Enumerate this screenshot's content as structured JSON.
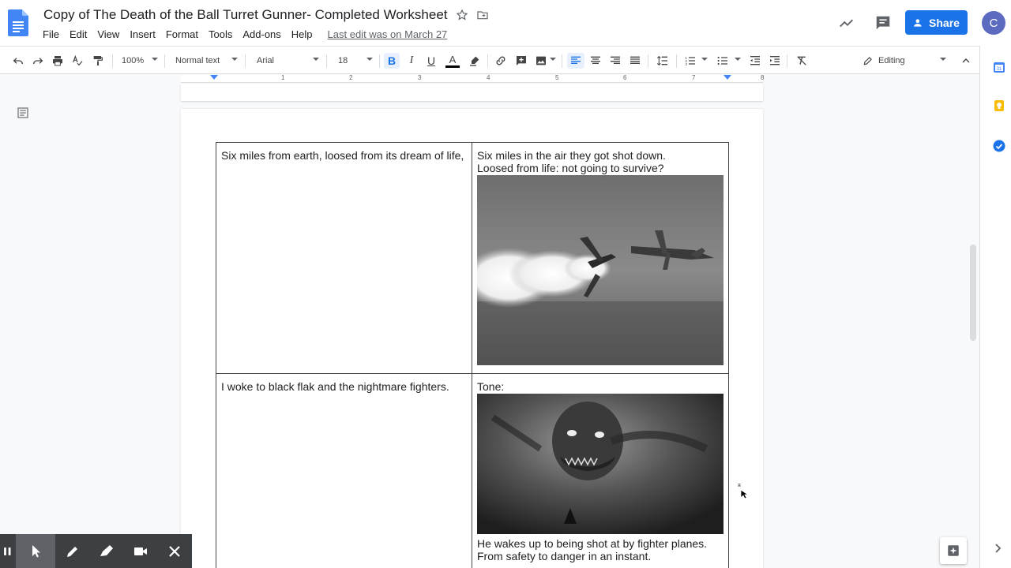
{
  "document": {
    "title": "Copy of The Death of the Ball Turret Gunner- Completed Worksheet",
    "last_edit": "Last edit was on March 27"
  },
  "menu": [
    "File",
    "Edit",
    "View",
    "Insert",
    "Format",
    "Tools",
    "Add-ons",
    "Help"
  ],
  "header": {
    "share_label": "Share",
    "avatar_letter": "C"
  },
  "toolbar": {
    "zoom": "100%",
    "style": "Normal text",
    "font": "Arial",
    "font_size": "18",
    "bold_label": "B",
    "italic_label": "I",
    "underline_label": "U",
    "text_color_label": "A",
    "mode": "Editing"
  },
  "ruler": {
    "numbers": [
      "1",
      "2",
      "3",
      "4",
      "5",
      "6",
      "7",
      "8"
    ]
  },
  "table": {
    "rows": [
      {
        "line": "Six miles from earth, loosed from its dream of life,",
        "note_lines": [
          "Six miles in the air they got shot down.",
          "Loosed from life: not going to survive?"
        ],
        "note_after": ""
      },
      {
        "line": "I woke to black flak and the nightmare fighters.",
        "note_lines": [
          "Tone:"
        ],
        "note_after": "He wakes up to being shot at by fighter planes. From safety to danger in an instant."
      }
    ]
  },
  "colors": {
    "accent": "#1a73e8",
    "avatar": "#5c6bc0",
    "draw_bar": "#3c4043"
  }
}
